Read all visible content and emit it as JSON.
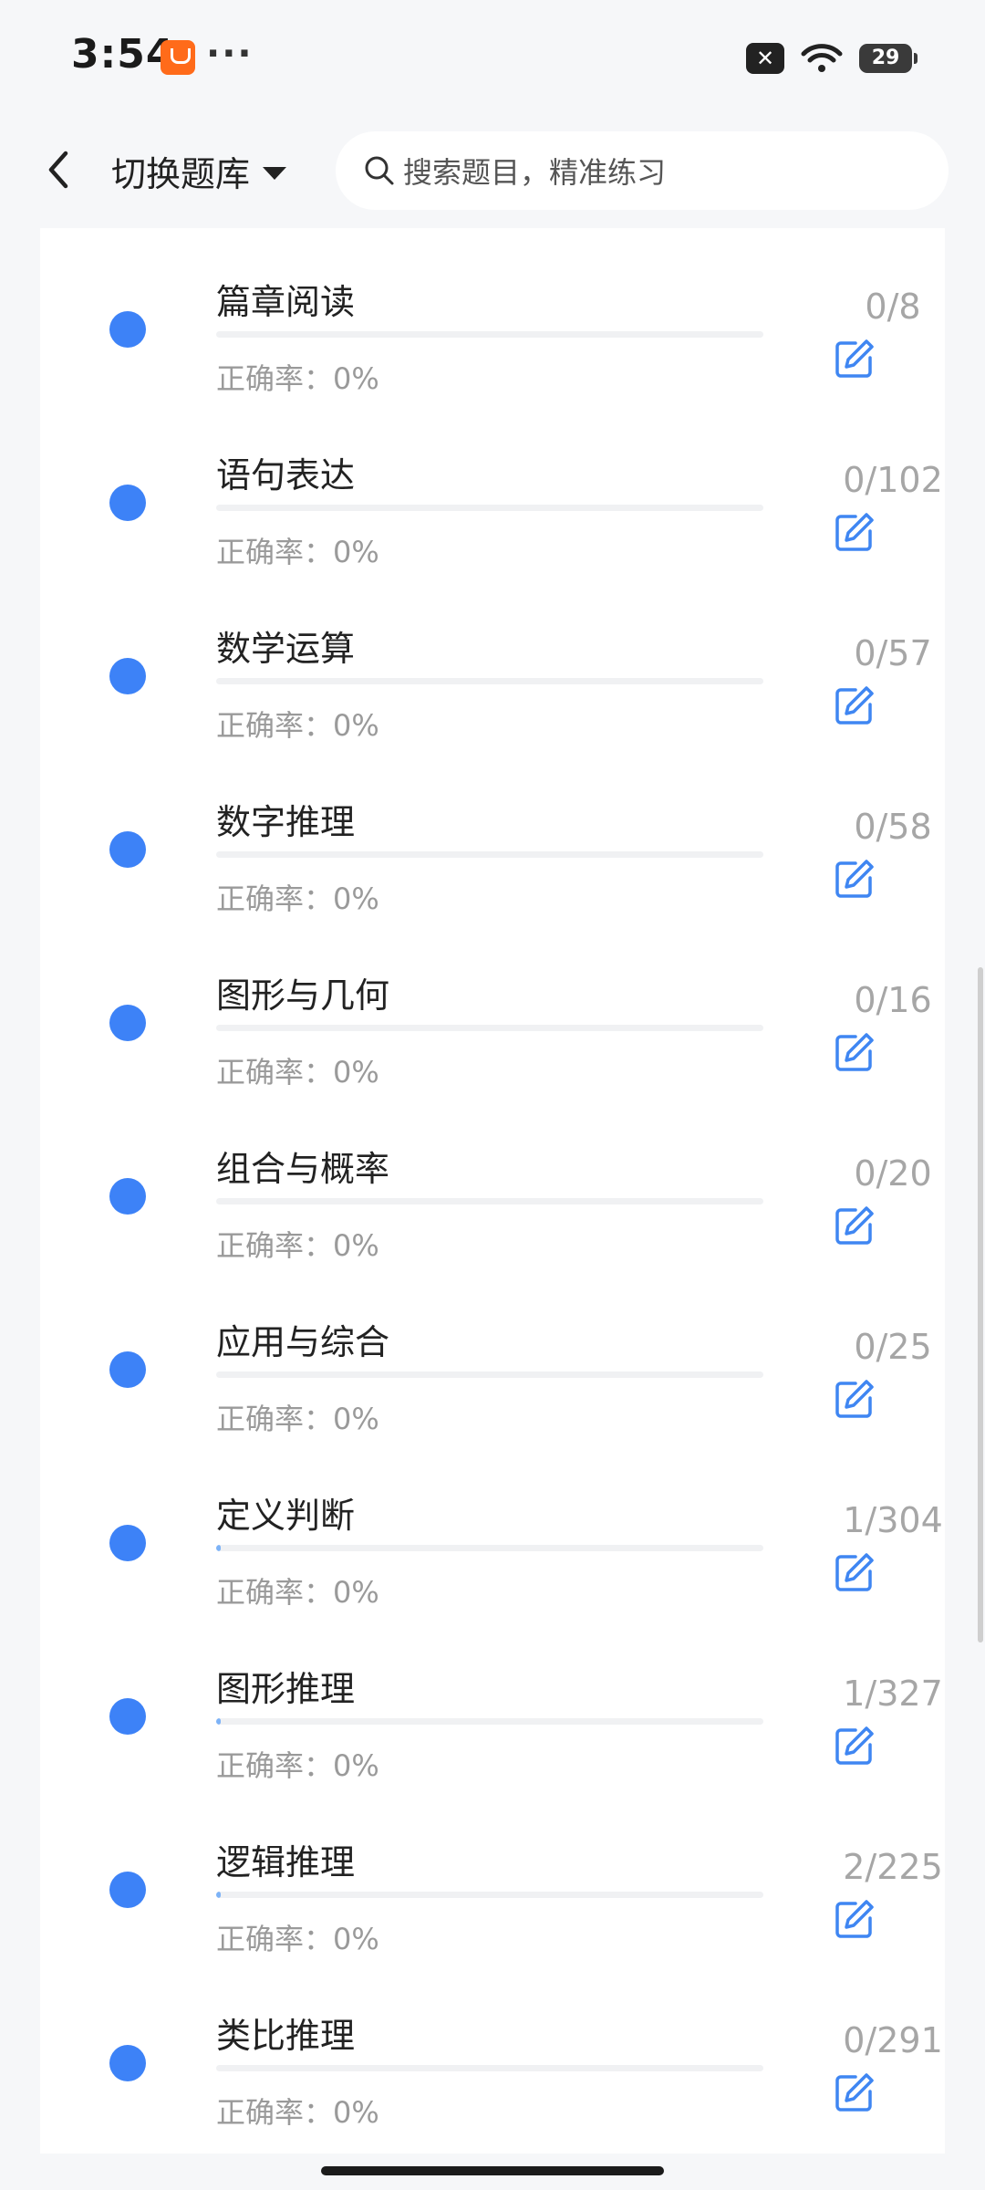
{
  "status_bar": {
    "time": "3:54",
    "more": "···",
    "battery": "29",
    "notification_badge": "✕"
  },
  "navbar": {
    "switch_label": "切换题库",
    "search_placeholder": "搜索题目，精准练习"
  },
  "colors": {
    "accent": "#3d82f7",
    "edit_icon": "#3f86f2",
    "muted_text": "#9a9a9a"
  },
  "list": {
    "accuracy_label": "正确率：",
    "items": [
      {
        "name": "篇章阅读",
        "count": "0/8",
        "accuracy": "0%",
        "progress": 0
      },
      {
        "name": "语句表达",
        "count": "0/102",
        "accuracy": "0%",
        "progress": 0
      },
      {
        "name": "数学运算",
        "count": "0/57",
        "accuracy": "0%",
        "progress": 0
      },
      {
        "name": "数字推理",
        "count": "0/58",
        "accuracy": "0%",
        "progress": 0
      },
      {
        "name": "图形与几何",
        "count": "0/16",
        "accuracy": "0%",
        "progress": 0
      },
      {
        "name": "组合与概率",
        "count": "0/20",
        "accuracy": "0%",
        "progress": 0
      },
      {
        "name": "应用与综合",
        "count": "0/25",
        "accuracy": "0%",
        "progress": 0
      },
      {
        "name": "定义判断",
        "count": "1/304",
        "accuracy": "0%",
        "progress": 0.0033
      },
      {
        "name": "图形推理",
        "count": "1/327",
        "accuracy": "0%",
        "progress": 0.0031
      },
      {
        "name": "逻辑推理",
        "count": "2/225",
        "accuracy": "0%",
        "progress": 0.0089
      },
      {
        "name": "类比推理",
        "count": "0/291",
        "accuracy": "0%",
        "progress": 0
      }
    ]
  }
}
